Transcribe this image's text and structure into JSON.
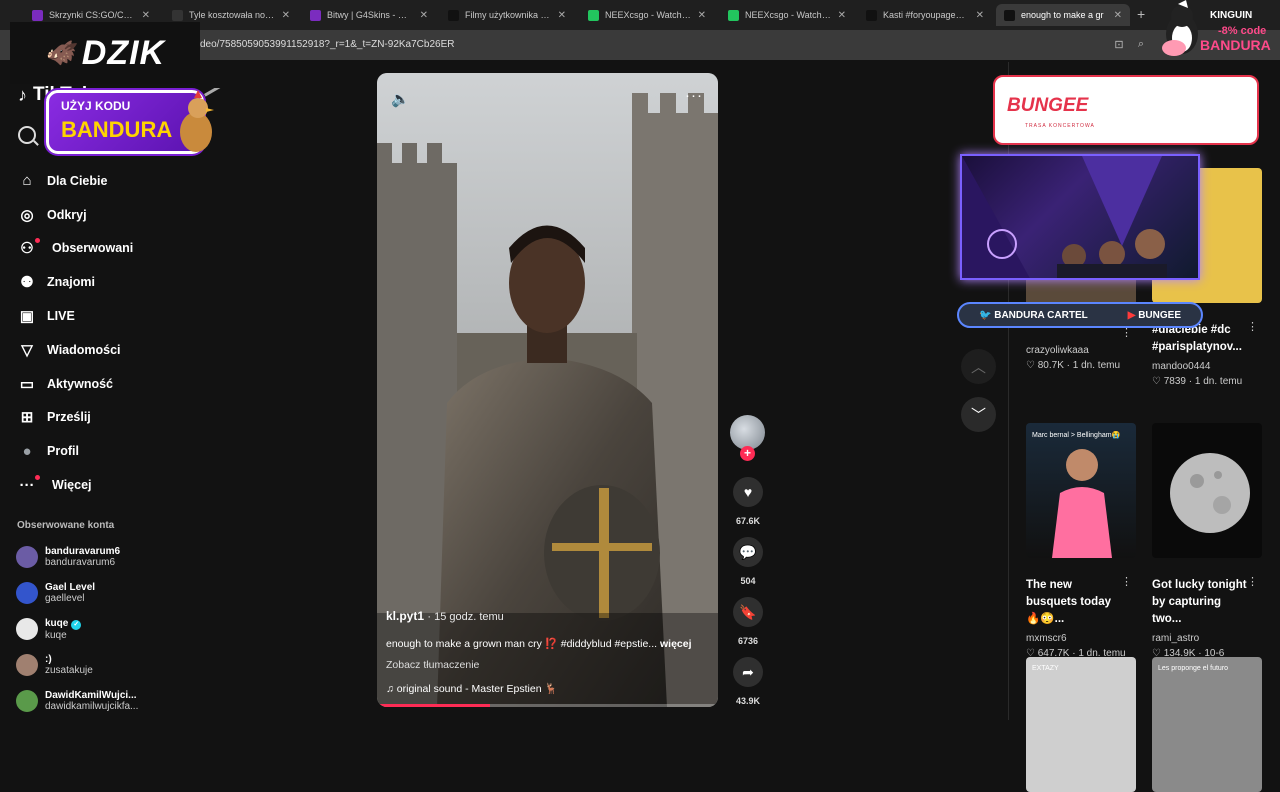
{
  "browser": {
    "tabs": [
      {
        "label": "Skrzynki CS:GO/CS2 | G4S",
        "color": "#7b2cbf"
      },
      {
        "label": "Tyle kosztowała nowa me",
        "color": "#333333"
      },
      {
        "label": "Bitwy | G4Skins - Otwiera",
        "color": "#7b2cbf"
      },
      {
        "label": "Filmy użytkownika Piotrek",
        "color": "#111111"
      },
      {
        "label": "NEEXcsgo - Watch clips o",
        "color": "#22c55e"
      },
      {
        "label": "NEEXcsgo - Watch clips o",
        "color": "#22c55e"
      },
      {
        "label": "Kasti #foryoupage💗💗",
        "color": "#111111"
      },
      {
        "label": "enough to make a gr",
        "color": "#111111"
      }
    ],
    "url": "deo/7585059053991152918?_r=1&_t=ZN-92Ka7Cb26ER"
  },
  "overlays": {
    "dzik": "DZIK",
    "uzyj_line1": "UŻYJ KODU",
    "uzyj_code": "BANDURA",
    "kinguin_brand": "KINGUIN",
    "kinguin_pct": "-8% code",
    "kinguin_code": "BANDURA",
    "bungee_title": "BUNGEE",
    "bungee_sub": "TRASA KONCERTOWA",
    "stream_twitter": "BANDURA  CARTEL",
    "stream_youtube": "BUNGEE"
  },
  "sidebar": {
    "logo": "TikTok",
    "nav": [
      {
        "label": "Dla Ciebie",
        "icon": "home-icon",
        "glyph": "⌂"
      },
      {
        "label": "Odkryj",
        "icon": "compass-icon",
        "glyph": "◎"
      },
      {
        "label": "Obserwowani",
        "icon": "user-follow-icon",
        "glyph": "⚇",
        "dot": true
      },
      {
        "label": "Znajomi",
        "icon": "friends-icon",
        "glyph": "⚉"
      },
      {
        "label": "LIVE",
        "icon": "live-icon",
        "glyph": "▣"
      },
      {
        "label": "Wiadomości",
        "icon": "send-icon",
        "glyph": "▽"
      },
      {
        "label": "Aktywność",
        "icon": "inbox-icon",
        "glyph": "▭"
      },
      {
        "label": "Prześlij",
        "icon": "upload-icon",
        "glyph": "⊞"
      },
      {
        "label": "Profil",
        "icon": "profile-icon",
        "glyph": "●"
      },
      {
        "label": "Więcej",
        "icon": "more-icon",
        "glyph": "···",
        "dot": true
      }
    ],
    "following_header": "Obserwowane konta",
    "accounts": [
      {
        "name": "banduravarum6",
        "handle": "banduravarum6",
        "color": "#6b5ca5"
      },
      {
        "name": "Gael Level",
        "handle": "gaellevel",
        "color": "#3355cc"
      },
      {
        "name": "kuqe",
        "handle": "kuqe",
        "color": "#e8e8e8",
        "verified": true
      },
      {
        "name": ":)",
        "handle": "zusatakuje",
        "color": "#a08070"
      },
      {
        "name": "DawidKamilWujci...",
        "handle": "dawidkamilwujcikfa...",
        "color": "#5a9a4a"
      }
    ]
  },
  "video": {
    "username": "kl.pyt1",
    "time": "· 15 godz. temu",
    "description": "enough to make a grown man cry ⁉️ #diddyblud #epstie...",
    "more": "więcej",
    "translate": "Zobacz tłumaczenie",
    "sound": "original sound - Master Epstien 🦌",
    "progress": 0.33
  },
  "actions": {
    "likes": "67.6K",
    "comments": "504",
    "saves": "6736",
    "shares": "43.9K"
  },
  "grid": {
    "cards": [
      {
        "title": "",
        "user": "crazyoliwkaaa",
        "likes": "80.7K",
        "when": "1 dn. temu"
      },
      {
        "title": "#dlaciebie #dc #parisplatynov...",
        "user": "mandoo0444",
        "likes": "7839",
        "when": "1 dn. temu"
      },
      {
        "title": "The new busquets today 🔥😳...",
        "user": "mxmscr6",
        "likes": "647.7K",
        "when": "1 dn. temu",
        "thumb_text": "Marc bernal > Bellingham😭"
      },
      {
        "title": "Got lucky tonight by capturing two...",
        "user": "rami_astro",
        "likes": "134.9K",
        "when": "10-6"
      },
      {
        "title": "",
        "user": "",
        "likes": "",
        "when": "",
        "thumb_text": "EXTAZY"
      },
      {
        "title": "",
        "user": "",
        "likes": "",
        "when": "",
        "thumb_text": "Les proponge el futuro"
      }
    ]
  }
}
